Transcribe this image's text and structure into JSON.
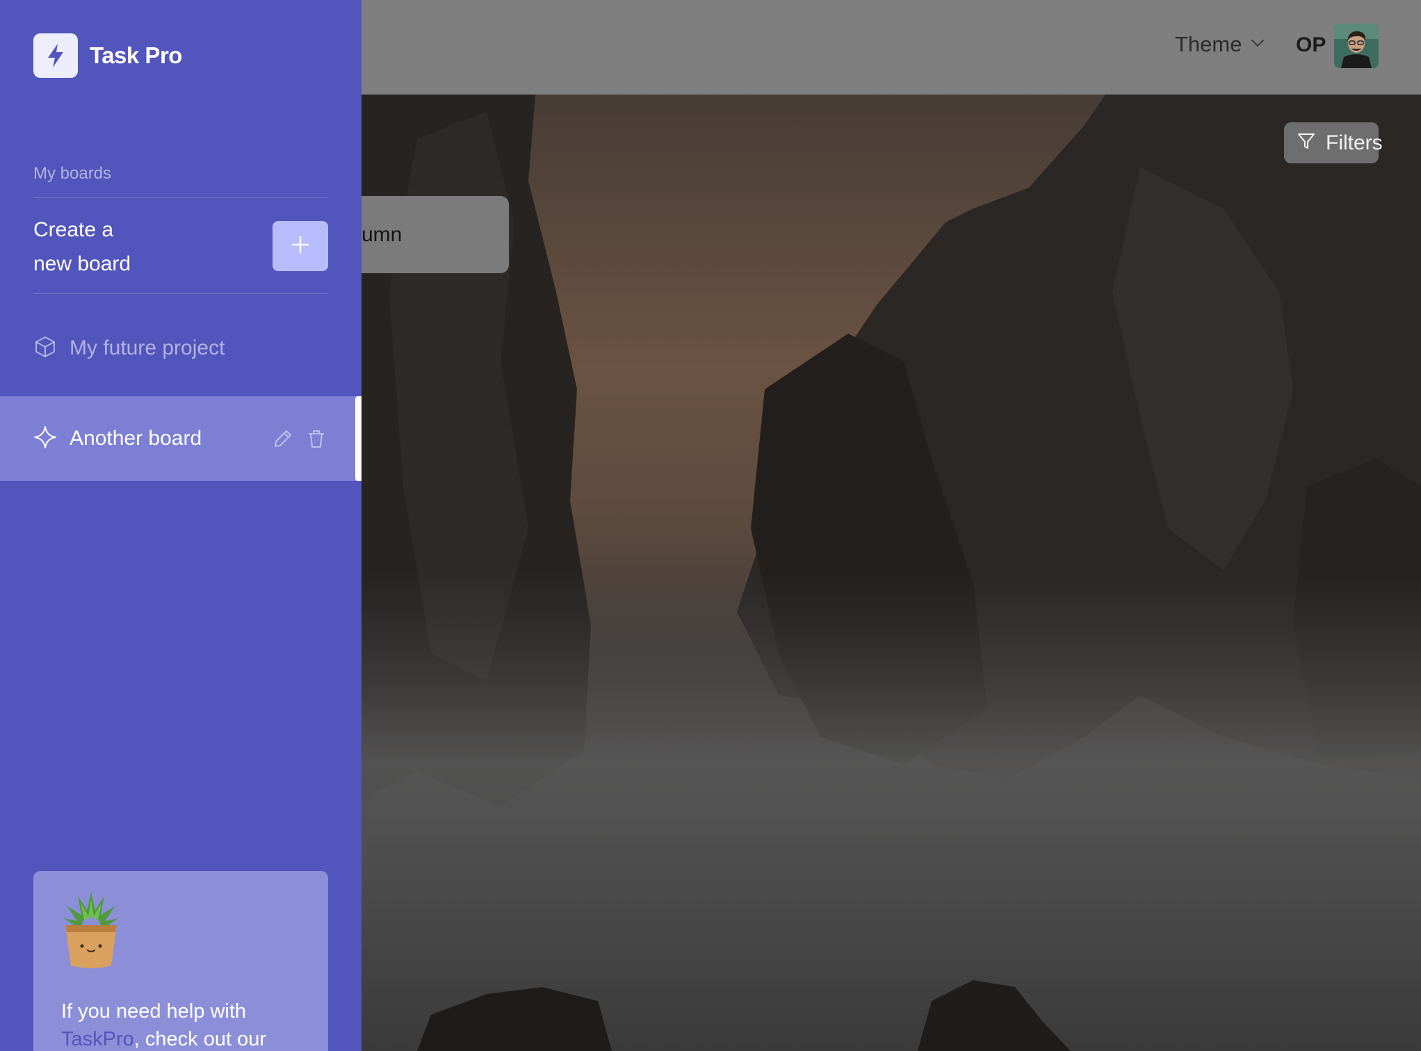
{
  "app": {
    "name": "Task Pro"
  },
  "header": {
    "theme_label": "Theme",
    "user_name": "OP"
  },
  "toolbar": {
    "filters_label": "Filters"
  },
  "board": {
    "add_column_partial_label": "umn"
  },
  "sidebar": {
    "section_label": "My boards",
    "create_label_line1": "Create a",
    "create_label_line2": "new board",
    "boards": [
      {
        "label": "My future project",
        "icon": "cube-icon",
        "active": false
      },
      {
        "label": "Another board",
        "icon": "sparkle-icon",
        "active": true
      }
    ]
  },
  "help": {
    "text_before_link": "If you need help with ",
    "link_text": "TaskPro",
    "text_after_link": ", check out our"
  },
  "colors": {
    "sidebar_bg": "#5255bc",
    "active_item_bg": "#7c7fd4",
    "create_button_bg": "#b8bcfd",
    "header_bg": "#7f7f7f"
  }
}
